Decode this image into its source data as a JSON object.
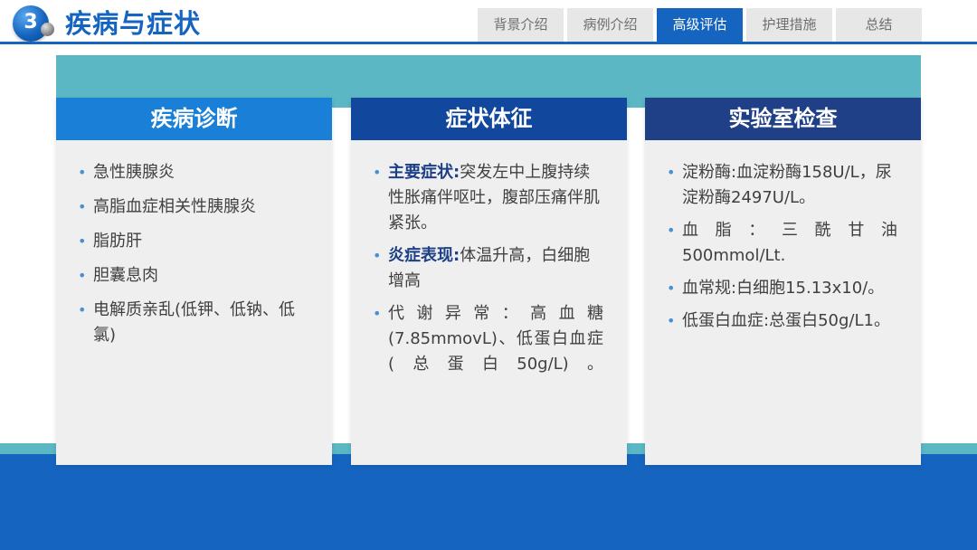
{
  "header": {
    "section_number": "3",
    "title": "疾病与症状",
    "tabs": [
      {
        "label": "背景介绍",
        "active": false
      },
      {
        "label": "病例介绍",
        "active": false
      },
      {
        "label": "高级评估",
        "active": true
      },
      {
        "label": "护理措施",
        "active": false
      },
      {
        "label": "总结",
        "active": false
      }
    ]
  },
  "colors": {
    "primary_blue": "#1565c0",
    "teal": "#5bb7c4",
    "card_head_1": "#1a7fd6",
    "card_head_2": "#11489d",
    "card_head_3": "#1f3f86",
    "card_bg": "#efefef",
    "keyword": "#1c3f86"
  },
  "cards": [
    {
      "title": "疾病诊断",
      "items": [
        {
          "text": "急性胰腺炎"
        },
        {
          "text": "高脂血症相关性胰腺炎"
        },
        {
          "text": "脂肪肝"
        },
        {
          "text": "胆囊息肉"
        },
        {
          "text": "电解质亲乱(低钾、低钠、低氯)"
        }
      ]
    },
    {
      "title": "症状体征",
      "items": [
        {
          "keyword": "主要症状:",
          "text": "突发左中上腹持续性胀痛伴呕吐，腹部压痛伴肌紧张。"
        },
        {
          "keyword": "炎症表现:",
          "text": "体温升高，白细胞增高"
        },
        {
          "keyword": "",
          "text": "代谢异常：高血糖(7.85mmovL)、低蛋白血症(总蛋白50g/L)。"
        }
      ]
    },
    {
      "title": "实验室检查",
      "items": [
        {
          "text": "淀粉酶:血淀粉酶158U/L，尿淀粉酶2497U/L。"
        },
        {
          "text": "血脂：三酰甘油500mmol/Lt."
        },
        {
          "text": "血常规:白细胞15.13x10/。"
        },
        {
          "text": "低蛋白血症:总蛋白50g/L1。"
        }
      ]
    }
  ]
}
